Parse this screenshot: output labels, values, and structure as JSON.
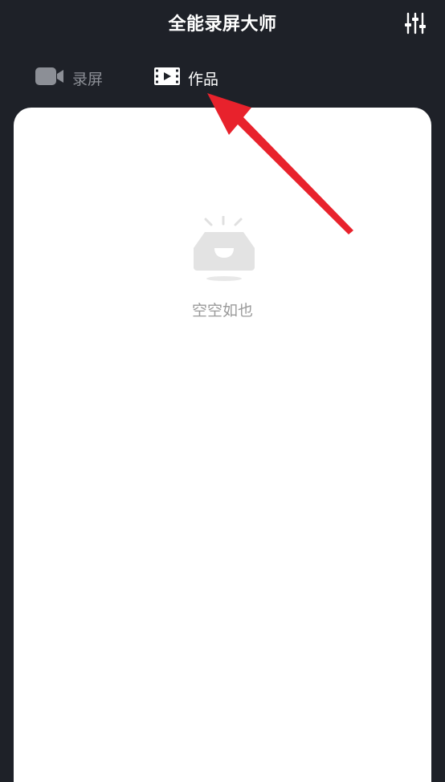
{
  "header": {
    "title": "全能录屏大师",
    "settings_icon": "sliders-icon"
  },
  "tabs": [
    {
      "label": "录屏",
      "icon": "video-camera-icon",
      "active": false
    },
    {
      "label": "作品",
      "icon": "film-strip-icon",
      "active": true
    }
  ],
  "empty_state": {
    "icon": "empty-tray-icon",
    "message": "空空如也"
  },
  "colors": {
    "background": "#1e2128",
    "panel": "#ffffff",
    "annotation_arrow": "#e8222c",
    "inactive_tab": "#8c8f96",
    "empty_text": "#9a9a9a"
  }
}
